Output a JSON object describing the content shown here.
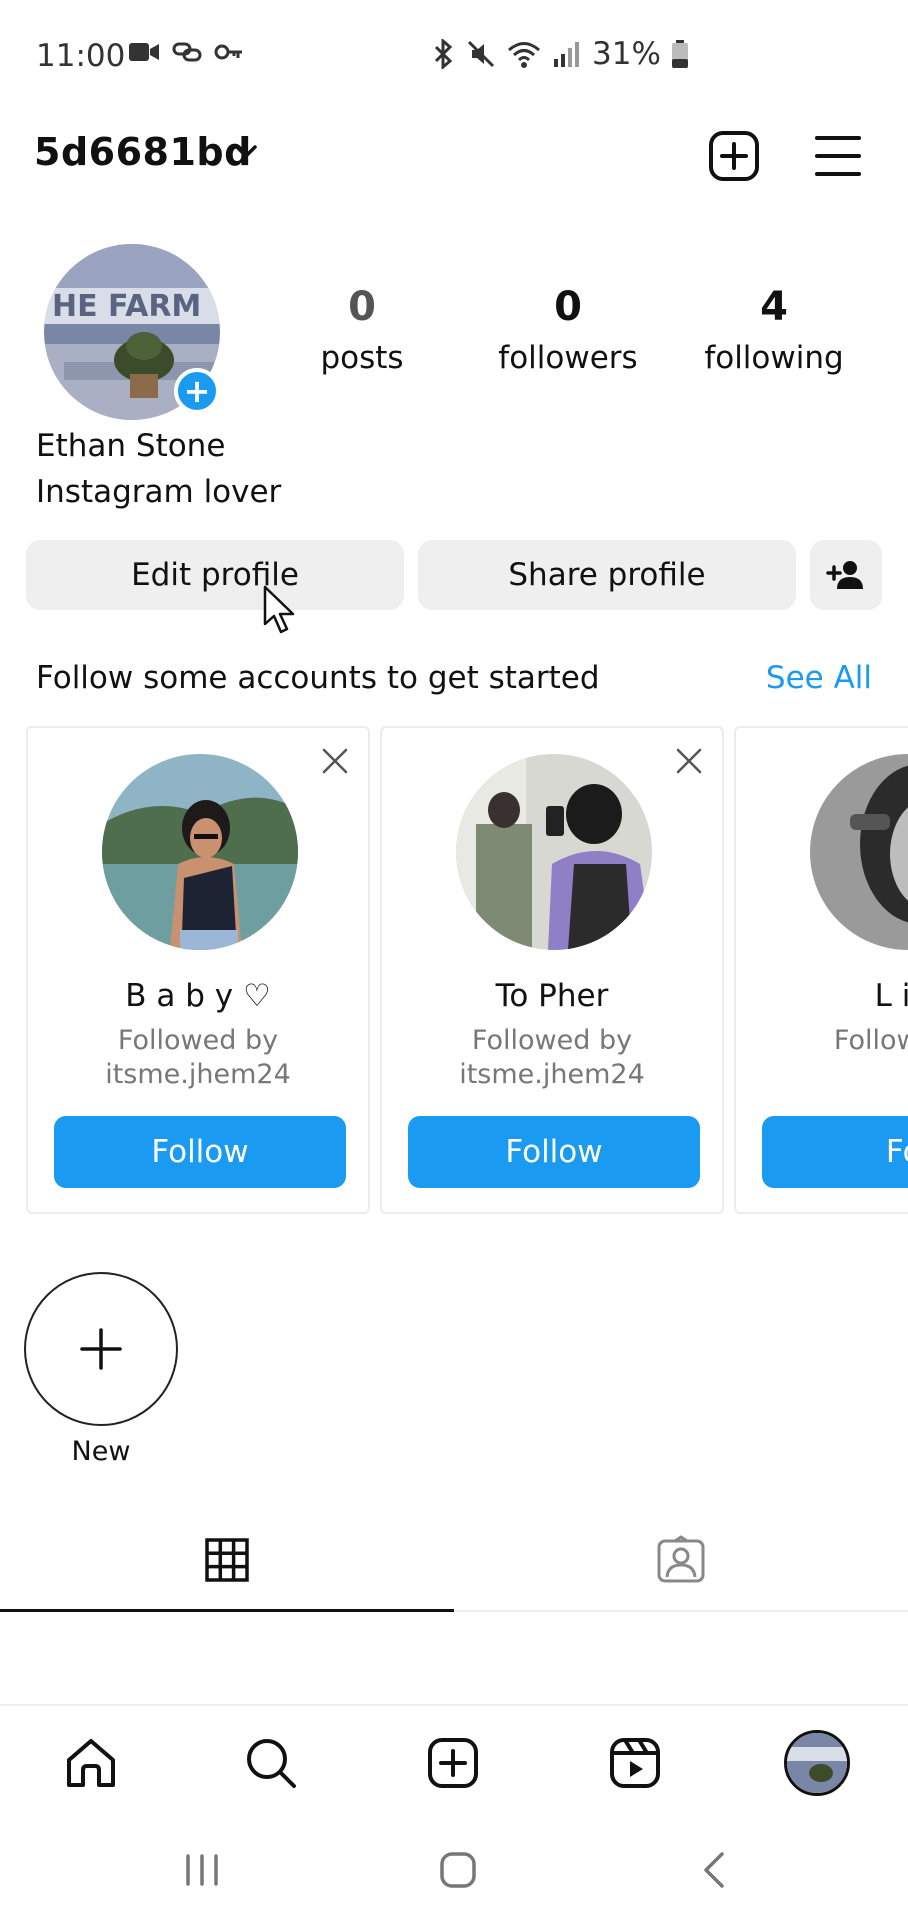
{
  "status_bar": {
    "time": "11:00",
    "battery": "31%"
  },
  "header": {
    "username": "5d6681bd"
  },
  "profile": {
    "stats": [
      {
        "value": "0",
        "label": "posts"
      },
      {
        "value": "0",
        "label": "followers"
      },
      {
        "value": "4",
        "label": "following"
      }
    ],
    "display_name": "Ethan Stone",
    "bio": "Instagram lover"
  },
  "actions": {
    "edit_label": "Edit profile",
    "share_label": "Share profile"
  },
  "suggestions": {
    "title": "Follow some accounts to get started",
    "see_all": "See All",
    "cards": [
      {
        "name": "B a b y ♡",
        "sub1": "Followed by",
        "sub2": "itsme.jhem24",
        "follow": "Follow"
      },
      {
        "name": "To Pher",
        "sub1": "Followed by",
        "sub2": "itsme.jhem24",
        "follow": "Follow"
      },
      {
        "name": "L i L",
        "sub1": "Followed b",
        "sub2": "",
        "follow": "Fol"
      }
    ]
  },
  "highlights": {
    "new_label": "New"
  },
  "colors": {
    "accent": "#1a9af0",
    "button_grey": "#efefef"
  }
}
